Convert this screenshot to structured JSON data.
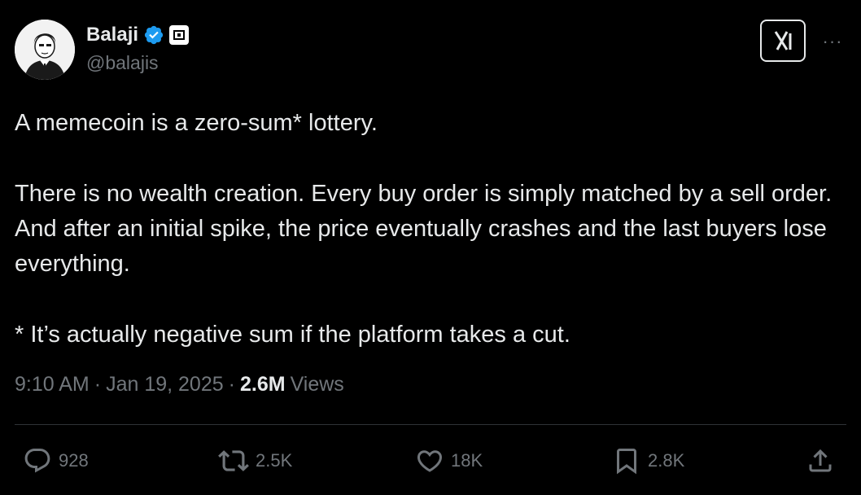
{
  "author": {
    "display_name": "Balaji",
    "handle": "@balajis",
    "avatar_icon": "avatar-illustration",
    "verified_icon": "verified-badge-icon",
    "affiliate_icon": "affiliate-badge-icon"
  },
  "header_actions": {
    "grok_icon": "grok-icon",
    "more_label": "···"
  },
  "tweet": {
    "paragraphs": [
      "A memecoin is a zero-sum* lottery.",
      "There is no wealth creation. Every buy order is simply matched by a sell order. And after an initial spike, the price eventually crashes and the last buyers lose everything.",
      "* It’s actually negative sum if the platform takes a cut."
    ]
  },
  "meta": {
    "time": "9:10 AM",
    "sep1": "·",
    "date": "Jan 19, 2025",
    "sep2": "·",
    "views_count": "2.6M",
    "views_label": "Views"
  },
  "actions": {
    "replies": "928",
    "reposts": "2.5K",
    "likes": "18K",
    "bookmarks": "2.8K"
  },
  "colors": {
    "background": "#000000",
    "text": "#e7e9ea",
    "secondary": "#71767b",
    "verified": "#1d9bf0",
    "divider": "#2f3336"
  }
}
